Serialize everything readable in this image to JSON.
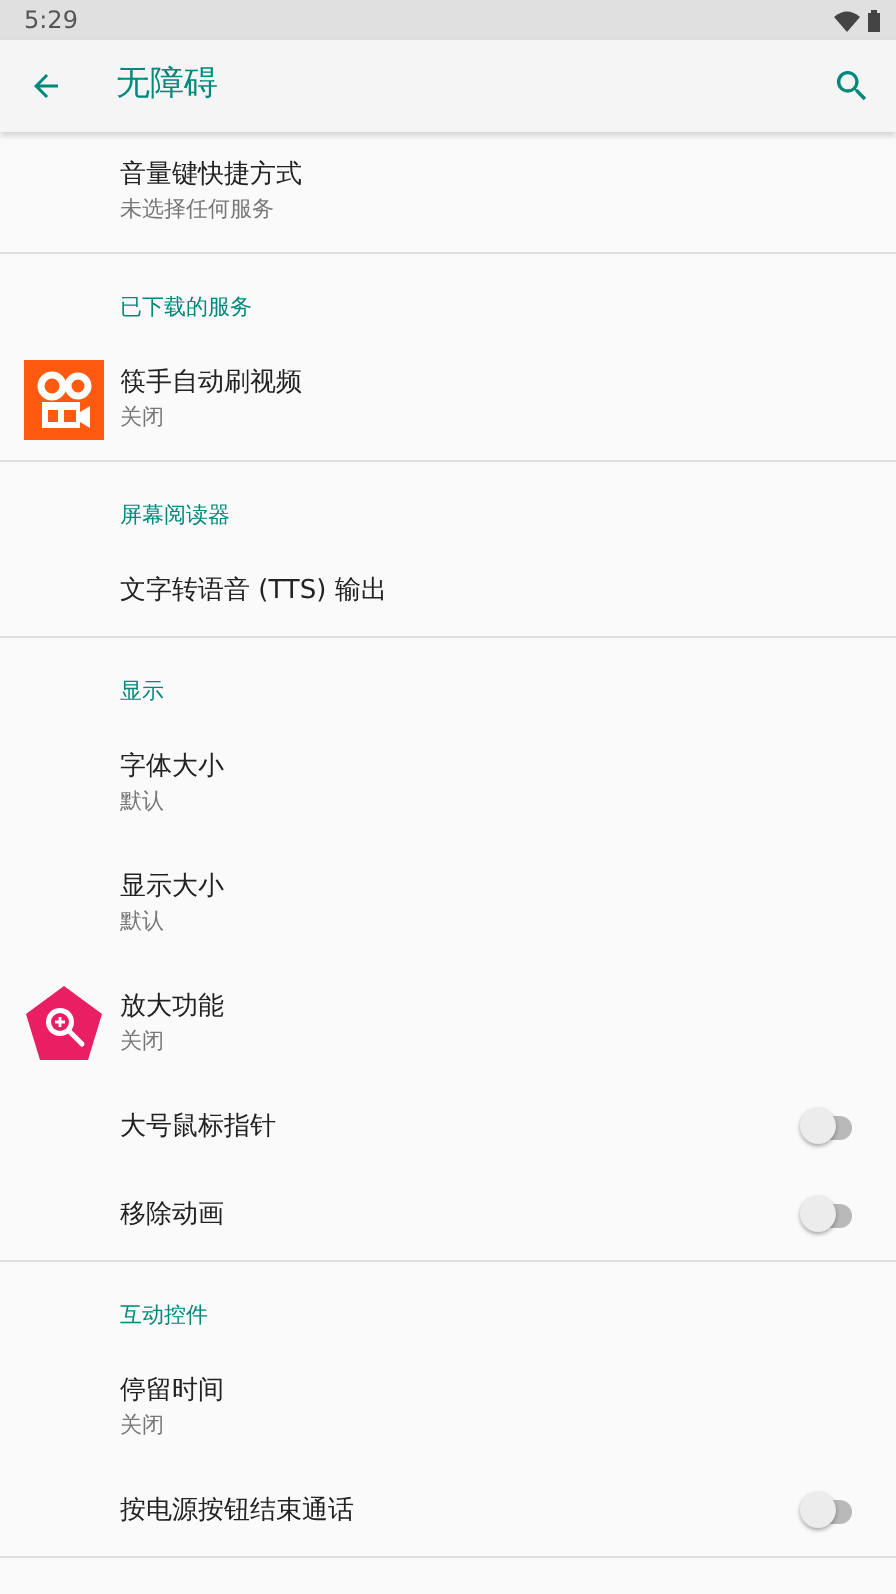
{
  "status_bar": {
    "time": "5:29"
  },
  "app_bar": {
    "title": "无障碍"
  },
  "sections": [
    {
      "items": [
        {
          "kind": "setting",
          "title": "音量键快捷方式",
          "summary": "未选择任何服务"
        }
      ]
    },
    {
      "header": "已下载的服务",
      "items": [
        {
          "kind": "service",
          "title": "筷手自动刷视频",
          "summary": "关闭"
        }
      ]
    },
    {
      "header": "屏幕阅读器",
      "items": [
        {
          "kind": "setting",
          "title": "文字转语音 (TTS) 输出"
        }
      ]
    },
    {
      "header": "显示",
      "items": [
        {
          "kind": "setting",
          "title": "字体大小",
          "summary": "默认"
        },
        {
          "kind": "setting",
          "title": "显示大小",
          "summary": "默认"
        },
        {
          "kind": "magnifier",
          "title": "放大功能",
          "summary": "关闭"
        },
        {
          "kind": "toggle",
          "title": "大号鼠标指针",
          "on": false
        },
        {
          "kind": "toggle",
          "title": "移除动画",
          "on": false
        }
      ]
    },
    {
      "header": "互动控件",
      "items": [
        {
          "kind": "setting",
          "title": "停留时间",
          "summary": "关闭"
        },
        {
          "kind": "toggle",
          "title": "按电源按钮结束通话",
          "on": false
        }
      ]
    }
  ]
}
